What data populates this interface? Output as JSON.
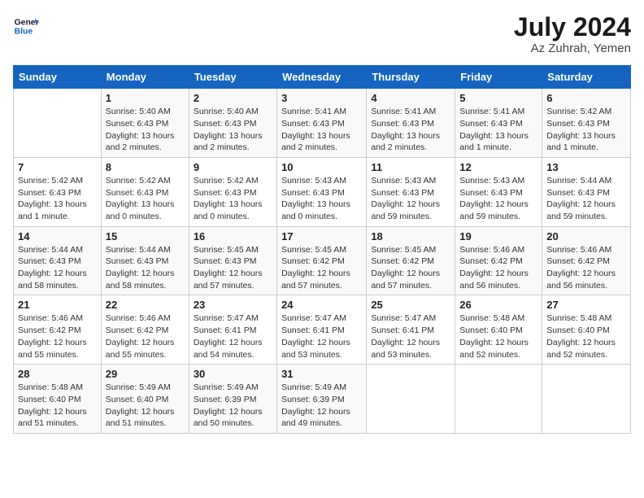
{
  "header": {
    "logo_line1": "General",
    "logo_line2": "Blue",
    "month_year": "July 2024",
    "location": "Az Zuhrah, Yemen"
  },
  "days_of_week": [
    "Sunday",
    "Monday",
    "Tuesday",
    "Wednesday",
    "Thursday",
    "Friday",
    "Saturday"
  ],
  "weeks": [
    [
      {
        "day": "",
        "info": ""
      },
      {
        "day": "1",
        "info": "Sunrise: 5:40 AM\nSunset: 6:43 PM\nDaylight: 13 hours\nand 2 minutes."
      },
      {
        "day": "2",
        "info": "Sunrise: 5:40 AM\nSunset: 6:43 PM\nDaylight: 13 hours\nand 2 minutes."
      },
      {
        "day": "3",
        "info": "Sunrise: 5:41 AM\nSunset: 6:43 PM\nDaylight: 13 hours\nand 2 minutes."
      },
      {
        "day": "4",
        "info": "Sunrise: 5:41 AM\nSunset: 6:43 PM\nDaylight: 13 hours\nand 2 minutes."
      },
      {
        "day": "5",
        "info": "Sunrise: 5:41 AM\nSunset: 6:43 PM\nDaylight: 13 hours\nand 1 minute."
      },
      {
        "day": "6",
        "info": "Sunrise: 5:42 AM\nSunset: 6:43 PM\nDaylight: 13 hours\nand 1 minute."
      }
    ],
    [
      {
        "day": "7",
        "info": "Sunrise: 5:42 AM\nSunset: 6:43 PM\nDaylight: 13 hours\nand 1 minute."
      },
      {
        "day": "8",
        "info": "Sunrise: 5:42 AM\nSunset: 6:43 PM\nDaylight: 13 hours\nand 0 minutes."
      },
      {
        "day": "9",
        "info": "Sunrise: 5:42 AM\nSunset: 6:43 PM\nDaylight: 13 hours\nand 0 minutes."
      },
      {
        "day": "10",
        "info": "Sunrise: 5:43 AM\nSunset: 6:43 PM\nDaylight: 13 hours\nand 0 minutes."
      },
      {
        "day": "11",
        "info": "Sunrise: 5:43 AM\nSunset: 6:43 PM\nDaylight: 12 hours\nand 59 minutes."
      },
      {
        "day": "12",
        "info": "Sunrise: 5:43 AM\nSunset: 6:43 PM\nDaylight: 12 hours\nand 59 minutes."
      },
      {
        "day": "13",
        "info": "Sunrise: 5:44 AM\nSunset: 6:43 PM\nDaylight: 12 hours\nand 59 minutes."
      }
    ],
    [
      {
        "day": "14",
        "info": "Sunrise: 5:44 AM\nSunset: 6:43 PM\nDaylight: 12 hours\nand 58 minutes."
      },
      {
        "day": "15",
        "info": "Sunrise: 5:44 AM\nSunset: 6:43 PM\nDaylight: 12 hours\nand 58 minutes."
      },
      {
        "day": "16",
        "info": "Sunrise: 5:45 AM\nSunset: 6:43 PM\nDaylight: 12 hours\nand 57 minutes."
      },
      {
        "day": "17",
        "info": "Sunrise: 5:45 AM\nSunset: 6:42 PM\nDaylight: 12 hours\nand 57 minutes."
      },
      {
        "day": "18",
        "info": "Sunrise: 5:45 AM\nSunset: 6:42 PM\nDaylight: 12 hours\nand 57 minutes."
      },
      {
        "day": "19",
        "info": "Sunrise: 5:46 AM\nSunset: 6:42 PM\nDaylight: 12 hours\nand 56 minutes."
      },
      {
        "day": "20",
        "info": "Sunrise: 5:46 AM\nSunset: 6:42 PM\nDaylight: 12 hours\nand 56 minutes."
      }
    ],
    [
      {
        "day": "21",
        "info": "Sunrise: 5:46 AM\nSunset: 6:42 PM\nDaylight: 12 hours\nand 55 minutes."
      },
      {
        "day": "22",
        "info": "Sunrise: 5:46 AM\nSunset: 6:42 PM\nDaylight: 12 hours\nand 55 minutes."
      },
      {
        "day": "23",
        "info": "Sunrise: 5:47 AM\nSunset: 6:41 PM\nDaylight: 12 hours\nand 54 minutes."
      },
      {
        "day": "24",
        "info": "Sunrise: 5:47 AM\nSunset: 6:41 PM\nDaylight: 12 hours\nand 53 minutes."
      },
      {
        "day": "25",
        "info": "Sunrise: 5:47 AM\nSunset: 6:41 PM\nDaylight: 12 hours\nand 53 minutes."
      },
      {
        "day": "26",
        "info": "Sunrise: 5:48 AM\nSunset: 6:40 PM\nDaylight: 12 hours\nand 52 minutes."
      },
      {
        "day": "27",
        "info": "Sunrise: 5:48 AM\nSunset: 6:40 PM\nDaylight: 12 hours\nand 52 minutes."
      }
    ],
    [
      {
        "day": "28",
        "info": "Sunrise: 5:48 AM\nSunset: 6:40 PM\nDaylight: 12 hours\nand 51 minutes."
      },
      {
        "day": "29",
        "info": "Sunrise: 5:49 AM\nSunset: 6:40 PM\nDaylight: 12 hours\nand 51 minutes."
      },
      {
        "day": "30",
        "info": "Sunrise: 5:49 AM\nSunset: 6:39 PM\nDaylight: 12 hours\nand 50 minutes."
      },
      {
        "day": "31",
        "info": "Sunrise: 5:49 AM\nSunset: 6:39 PM\nDaylight: 12 hours\nand 49 minutes."
      },
      {
        "day": "",
        "info": ""
      },
      {
        "day": "",
        "info": ""
      },
      {
        "day": "",
        "info": ""
      }
    ]
  ]
}
